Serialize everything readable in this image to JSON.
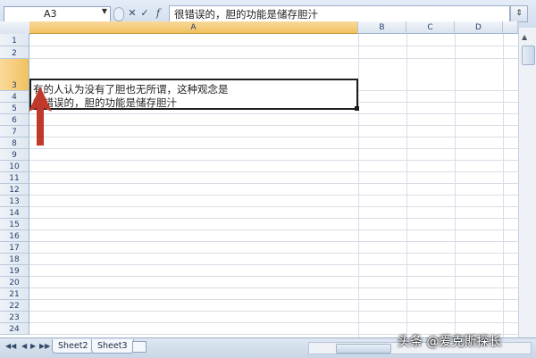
{
  "formula_bar": {
    "name_box": "A3",
    "formula_text": "很错误的，胆的功能是储存胆汁"
  },
  "grid": {
    "columns": [
      "A",
      "B",
      "C",
      "D"
    ],
    "active_column": "A",
    "rows": [
      "1",
      "2",
      "3",
      "4",
      "5",
      "6",
      "7",
      "8",
      "9",
      "10",
      "11",
      "12",
      "13",
      "14",
      "15",
      "16",
      "17",
      "18",
      "19",
      "20",
      "21",
      "22",
      "23",
      "24"
    ],
    "active_row": "3",
    "cell_a3": {
      "line1": "有的人认为没有了胆也无所谓，这种观念是",
      "line2": "很错误的，胆的功能是储存胆汁"
    }
  },
  "sheet_tabs": [
    "Sheet2",
    "Sheet3"
  ],
  "watermark": "头条 @爱克斯探长",
  "colors": {
    "arrow": "#c0392b",
    "active_header": "#f1c15f"
  }
}
